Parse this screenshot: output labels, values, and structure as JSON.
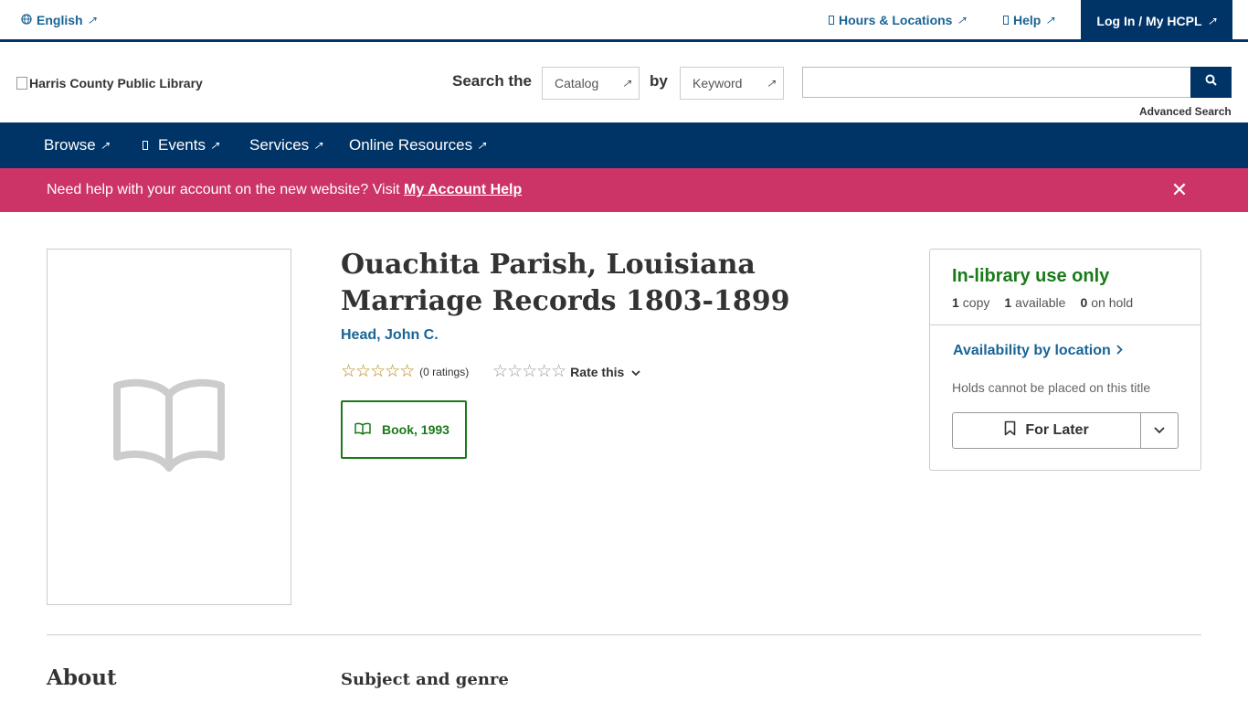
{
  "topbar": {
    "language": "English",
    "hours": "Hours & Locations",
    "help": "Help",
    "login": "Log In / My HCPL"
  },
  "header": {
    "logo_alt": "Harris County Public Library",
    "search_the": "Search the",
    "catalog": "Catalog",
    "by": "by",
    "keyword": "Keyword",
    "search_value": "",
    "advanced_search": "Advanced Search"
  },
  "nav": {
    "items": [
      {
        "label": "Browse"
      },
      {
        "label": "Events"
      },
      {
        "label": "Services"
      },
      {
        "label": "Online Resources"
      }
    ]
  },
  "alert": {
    "text": "Need help with your account on the new website? Visit ",
    "link": "My Account Help"
  },
  "record": {
    "title": "Ouachita Parish, Louisiana Marriage Records 1803-1899",
    "author": "Head, John C.",
    "rating_count": "(0 ratings)",
    "rate_label": "Rate this",
    "format": "Book, 1993"
  },
  "availability": {
    "status": "In-library use only",
    "copies_num": "1",
    "copies_label": "copy",
    "available_num": "1",
    "available_label": "available",
    "hold_num": "0",
    "hold_label": "on hold",
    "by_location": "Availability by location",
    "holds_note": "Holds cannot be placed on this title",
    "for_later": "For Later"
  },
  "sections": {
    "about": "About",
    "subject": "Subject and genre"
  },
  "icons": {
    "globe": "globe-icon",
    "external": "external-link-icon",
    "search": "search-icon",
    "close": "close-icon",
    "book": "book-icon",
    "bookmark": "bookmark-icon",
    "chevron": "chevron-down-icon"
  },
  "colors": {
    "navy": "#003366",
    "link_blue": "#1a6496",
    "alert_pink": "#cc3366",
    "available_green": "#1a7a1a"
  }
}
